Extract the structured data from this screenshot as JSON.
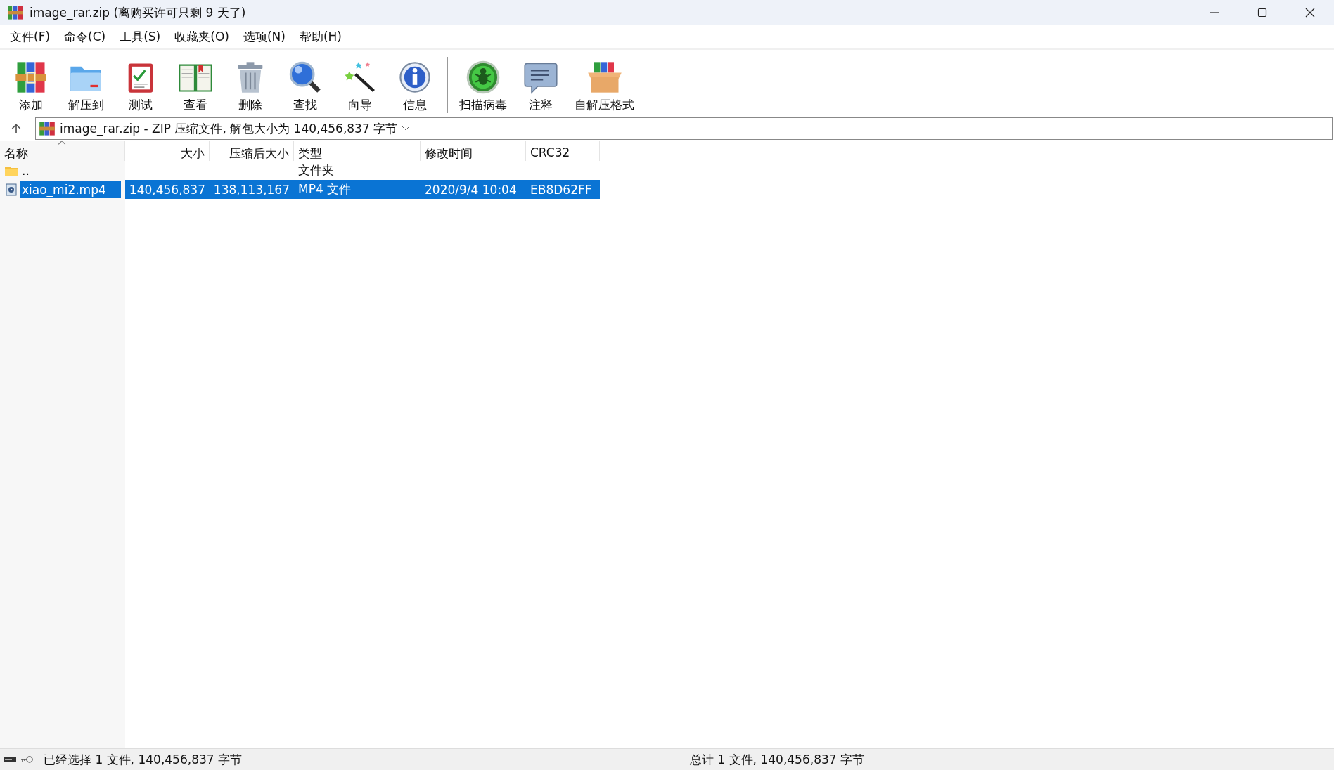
{
  "window": {
    "title": "image_rar.zip (离购买许可只剩 9 天了)"
  },
  "menu": [
    "文件(F)",
    "命令(C)",
    "工具(S)",
    "收藏夹(O)",
    "选项(N)",
    "帮助(H)"
  ],
  "toolbar": [
    {
      "label": "添加",
      "kind": "books"
    },
    {
      "label": "解压到",
      "kind": "folder"
    },
    {
      "label": "测试",
      "kind": "clipboard"
    },
    {
      "label": "查看",
      "kind": "book"
    },
    {
      "label": "删除",
      "kind": "trash"
    },
    {
      "label": "查找",
      "kind": "magnifier"
    },
    {
      "label": "向导",
      "kind": "wand"
    },
    {
      "label": "信息",
      "kind": "info"
    },
    {
      "label": "扫描病毒",
      "kind": "bug",
      "separator_before": true
    },
    {
      "label": "注释",
      "kind": "comment"
    },
    {
      "label": "自解压格式",
      "kind": "box"
    }
  ],
  "address": {
    "value": "image_rar.zip - ZIP 压缩文件, 解包大小为 140,456,837 字节"
  },
  "table": {
    "columns": [
      {
        "label": "名称",
        "sorted": true
      },
      {
        "label": "大小",
        "sorted": false
      },
      {
        "label": "压缩后大小",
        "sorted": false
      },
      {
        "label": "类型",
        "sorted": false
      },
      {
        "label": "修改时间",
        "sorted": false
      },
      {
        "label": "CRC32",
        "sorted": false
      }
    ],
    "rows": [
      {
        "kind": "folder",
        "selected": false,
        "cells": [
          "..",
          "",
          "",
          "文件夹",
          "",
          ""
        ]
      },
      {
        "kind": "video",
        "selected": true,
        "cells": [
          "xiao_mi2.mp4",
          "140,456,837",
          "138,113,167",
          "MP4 文件",
          "2020/9/4 10:04",
          "EB8D62FF"
        ]
      }
    ]
  },
  "status_bar": {
    "left": "已经选择 1 文件, 140,456,837 字节",
    "right": "总计 1 文件, 140,456,837 字节"
  }
}
